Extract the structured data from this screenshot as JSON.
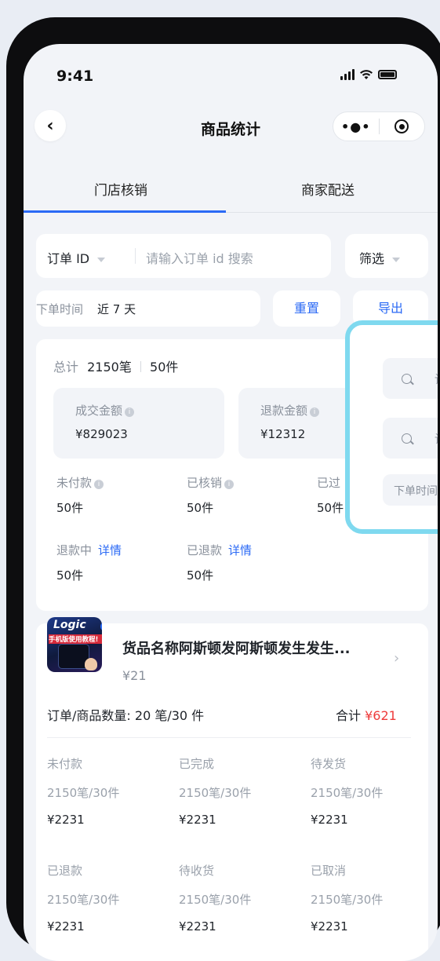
{
  "status_bar": {
    "time": "9:41"
  },
  "nav": {
    "back_icon": "chevron-left-icon",
    "title": "商品统计",
    "more_icon": "more-dots-icon",
    "target_icon": "target-icon"
  },
  "tabs": [
    {
      "label": "门店核销",
      "active": true
    },
    {
      "label": "商家配送",
      "active": false
    }
  ],
  "search": {
    "type_label": "订单 ID",
    "placeholder": "请输入订单 id 搜索",
    "filter_label": "筛选"
  },
  "time_filter": {
    "label": "下单时间",
    "value": "近 7 天",
    "reset_label": "重置",
    "export_label": "导出"
  },
  "summary": {
    "total_label": "总计",
    "orders": "2150笔",
    "items": "50件",
    "deal_amount_label": "成交金额",
    "deal_amount": "¥829023",
    "refund_amount_label": "退款金额",
    "refund_amount": "¥12312",
    "unpaid_label": "未付款",
    "unpaid_value": "50件",
    "verified_label": "已核销",
    "verified_value": "50件",
    "expired_label": "已过",
    "expired_value": "50件",
    "refunding_label": "退款中",
    "refunding_link": "详情",
    "refunding_value": "50件",
    "refunded_label": "已退款",
    "refunded_link": "详情",
    "refunded_value": "50件"
  },
  "overlay": {
    "field1_placeholder": "请",
    "field2_placeholder": "请",
    "field3_label": "下单时间"
  },
  "product": {
    "thumb_text": "手机版使用教程!",
    "thumb_top_text": "Logic",
    "name": "货品名称阿斯顿发阿斯顿发生发生...",
    "price": "¥21",
    "count_label": "订单/商品数量:",
    "count_value": "20 笔/30 件",
    "total_label": "合计",
    "total_value": "¥621",
    "stats": [
      {
        "label": "未付款",
        "count": "2150笔/30件",
        "amount": "¥2231"
      },
      {
        "label": "已完成",
        "count": "2150笔/30件",
        "amount": "¥2231"
      },
      {
        "label": "待发货",
        "count": "2150笔/30件",
        "amount": "¥2231"
      },
      {
        "label": "已退款",
        "count": "2150笔/30件",
        "amount": "¥2231"
      },
      {
        "label": "待收货",
        "count": "2150笔/30件",
        "amount": "¥2231"
      },
      {
        "label": "已取消",
        "count": "2150笔/30件",
        "amount": "¥2231"
      }
    ]
  },
  "colors": {
    "accent": "#2b6af5",
    "price_red": "#ee3b3b",
    "overlay_border": "#7fd9ef"
  }
}
